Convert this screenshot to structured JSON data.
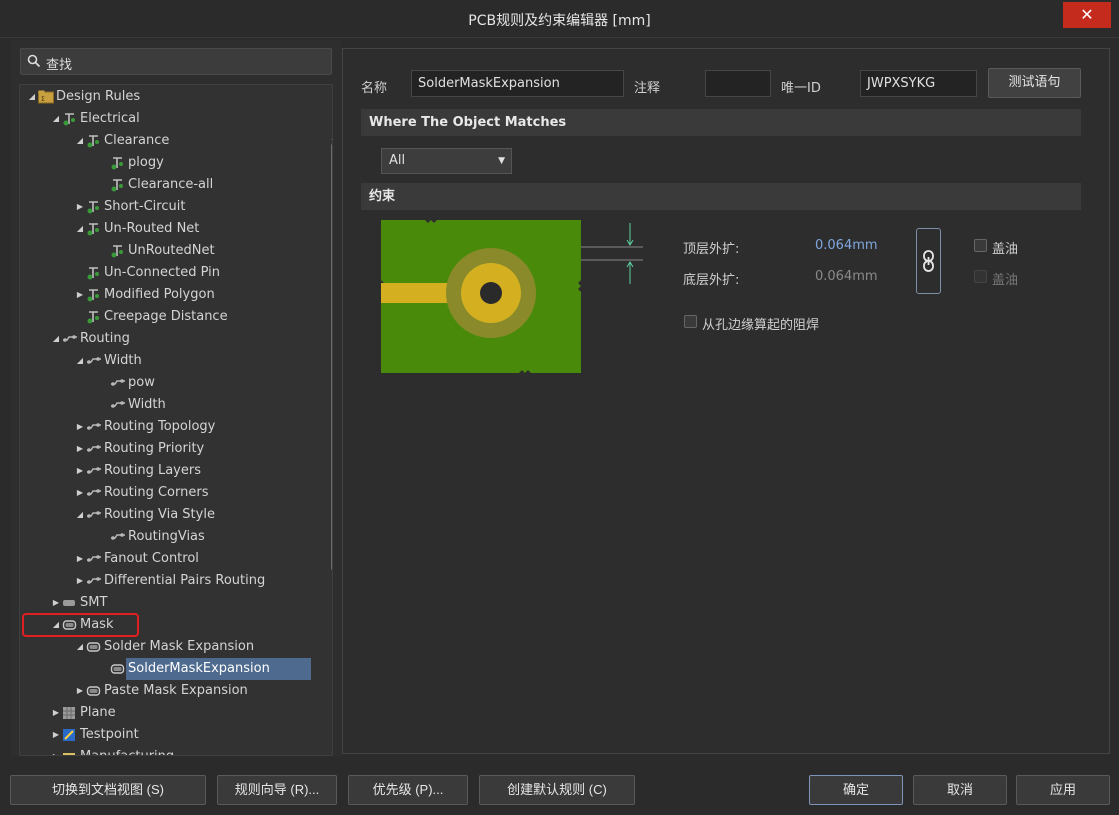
{
  "window": {
    "title": "PCB规则及约束编辑器 [mm]",
    "close_label": "✕"
  },
  "search": {
    "text": "查找"
  },
  "tree": [
    {
      "label": "Design Rules",
      "level": 0,
      "exp": "open",
      "icon": "folder"
    },
    {
      "label": "Electrical",
      "level": 1,
      "exp": "open",
      "icon": "rule-green"
    },
    {
      "label": "Clearance",
      "level": 2,
      "exp": "open",
      "icon": "rule-green"
    },
    {
      "label": "plogy",
      "level": 3,
      "exp": "none",
      "icon": "rule-green"
    },
    {
      "label": "Clearance-all",
      "level": 3,
      "exp": "none",
      "icon": "rule-green"
    },
    {
      "label": "Short-Circuit",
      "level": 2,
      "exp": "closed",
      "icon": "rule-green"
    },
    {
      "label": "Un-Routed Net",
      "level": 2,
      "exp": "open",
      "icon": "rule-green"
    },
    {
      "label": "UnRoutedNet",
      "level": 3,
      "exp": "none",
      "icon": "rule-green"
    },
    {
      "label": "Un-Connected Pin",
      "level": 2,
      "exp": "none",
      "icon": "rule-green"
    },
    {
      "label": "Modified Polygon",
      "level": 2,
      "exp": "closed",
      "icon": "rule-green"
    },
    {
      "label": "Creepage Distance",
      "level": 2,
      "exp": "none",
      "icon": "rule-green"
    },
    {
      "label": "Routing",
      "level": 1,
      "exp": "open",
      "icon": "routing"
    },
    {
      "label": "Width",
      "level": 2,
      "exp": "open",
      "icon": "routing"
    },
    {
      "label": "pow",
      "level": 3,
      "exp": "none",
      "icon": "routing"
    },
    {
      "label": "Width",
      "level": 3,
      "exp": "none",
      "icon": "routing"
    },
    {
      "label": "Routing Topology",
      "level": 2,
      "exp": "closed",
      "icon": "routing"
    },
    {
      "label": "Routing Priority",
      "level": 2,
      "exp": "closed",
      "icon": "routing"
    },
    {
      "label": "Routing Layers",
      "level": 2,
      "exp": "closed",
      "icon": "routing"
    },
    {
      "label": "Routing Corners",
      "level": 2,
      "exp": "closed",
      "icon": "routing"
    },
    {
      "label": "Routing Via Style",
      "level": 2,
      "exp": "open",
      "icon": "routing"
    },
    {
      "label": "RoutingVias",
      "level": 3,
      "exp": "none",
      "icon": "routing"
    },
    {
      "label": "Fanout Control",
      "level": 2,
      "exp": "closed",
      "icon": "routing"
    },
    {
      "label": "Differential Pairs Routing",
      "level": 2,
      "exp": "closed",
      "icon": "routing"
    },
    {
      "label": "SMT",
      "level": 1,
      "exp": "closed",
      "icon": "smt"
    },
    {
      "label": "Mask",
      "level": 1,
      "exp": "open",
      "icon": "mask"
    },
    {
      "label": "Solder Mask Expansion",
      "level": 2,
      "exp": "open",
      "icon": "mask"
    },
    {
      "label": "SolderMaskExpansion",
      "level": 3,
      "exp": "none",
      "icon": "mask",
      "selected": true
    },
    {
      "label": "Paste Mask Expansion",
      "level": 2,
      "exp": "closed",
      "icon": "mask"
    },
    {
      "label": "Plane",
      "level": 1,
      "exp": "closed",
      "icon": "plane"
    },
    {
      "label": "Testpoint",
      "level": 1,
      "exp": "closed",
      "icon": "testpoint"
    },
    {
      "label": "Manufacturing",
      "level": 1,
      "exp": "closed",
      "icon": "manufacturing"
    }
  ],
  "rule": {
    "name_label": "名称",
    "name_value": "SolderMaskExpansion",
    "comment_label": "注释",
    "comment_value": "",
    "uid_label": "唯一ID",
    "uid_value": "JWPXSYKG",
    "test_button": "测试语句"
  },
  "where": {
    "header": "Where The Object Matches",
    "selected": "All"
  },
  "constraints": {
    "header": "约束",
    "top_label": "顶层外扩:",
    "top_value": "0.064mm",
    "bottom_label": "底层外扩:",
    "bottom_value": "0.064mm",
    "tent_top_label": "盖油",
    "tent_bottom_label": "盖油",
    "from_hole_label": "从孔边缘算起的阻焊"
  },
  "buttons": {
    "doc_view": "切换到文档视图 (S)",
    "wizard": "规则向导 (R)...",
    "priority": "优先级 (P)...",
    "default_rules": "创建默认规则 (C)",
    "ok": "确定",
    "cancel": "取消",
    "apply": "应用"
  },
  "colors": {
    "accent_value": "#7fa7df",
    "pcb_green": "#4a8a0a",
    "copper": "#d4b020",
    "selection": "#4e6a8e"
  }
}
